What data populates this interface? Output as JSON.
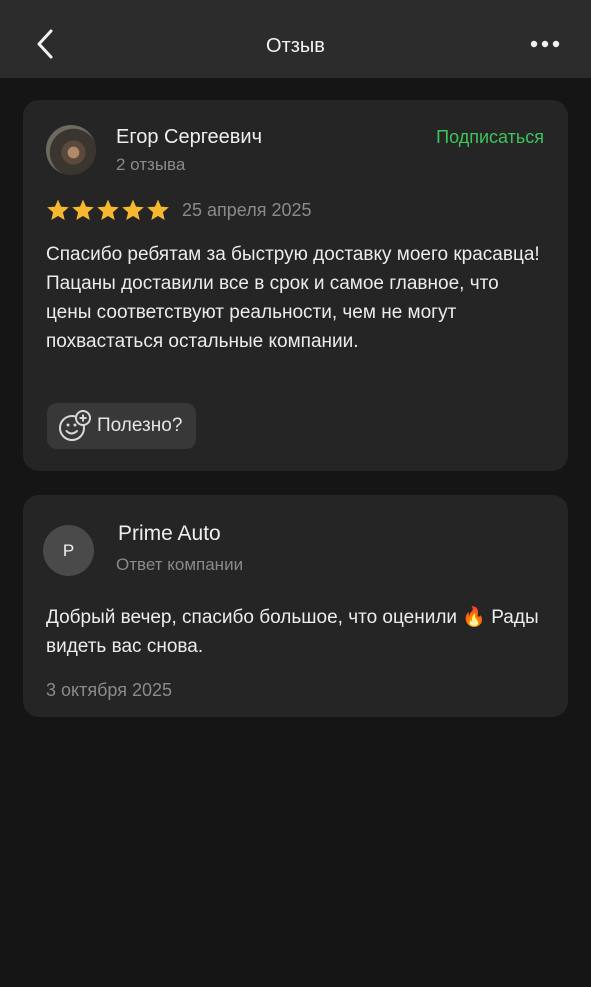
{
  "header": {
    "title": "Отзыв",
    "back_icon": "chevron-left-icon",
    "more_icon": "more-horizontal-icon"
  },
  "review": {
    "author": "Егор Сергеевич",
    "meta": "2 отзыва",
    "subscribe_label": "Подписаться",
    "rating": 5,
    "rating_max": 5,
    "date": "25 апреля 2025",
    "text": "Спасибо ребятам за быструю доставку моего красавца! Пацаны доставили все в срок и самое главное, что цены соответствуют реальности, чем не могут похвастаться остальные компании.",
    "helpful_label": "Полезно?",
    "helpful_icon": "smile-add-icon"
  },
  "reply": {
    "avatar_letter": "P",
    "company": "Prime Auto",
    "subtitle": "Ответ компании",
    "text": "Добрый вечер, спасибо большое, что оценили 🔥 Рады видеть вас снова.",
    "date": "3 октября 2025"
  },
  "colors": {
    "background": "#151515",
    "header": "#2c2c2c",
    "card": "#252525",
    "accent_green": "#3dc45b",
    "star": "#f5b82e",
    "muted_text": "#8a8a8a"
  }
}
